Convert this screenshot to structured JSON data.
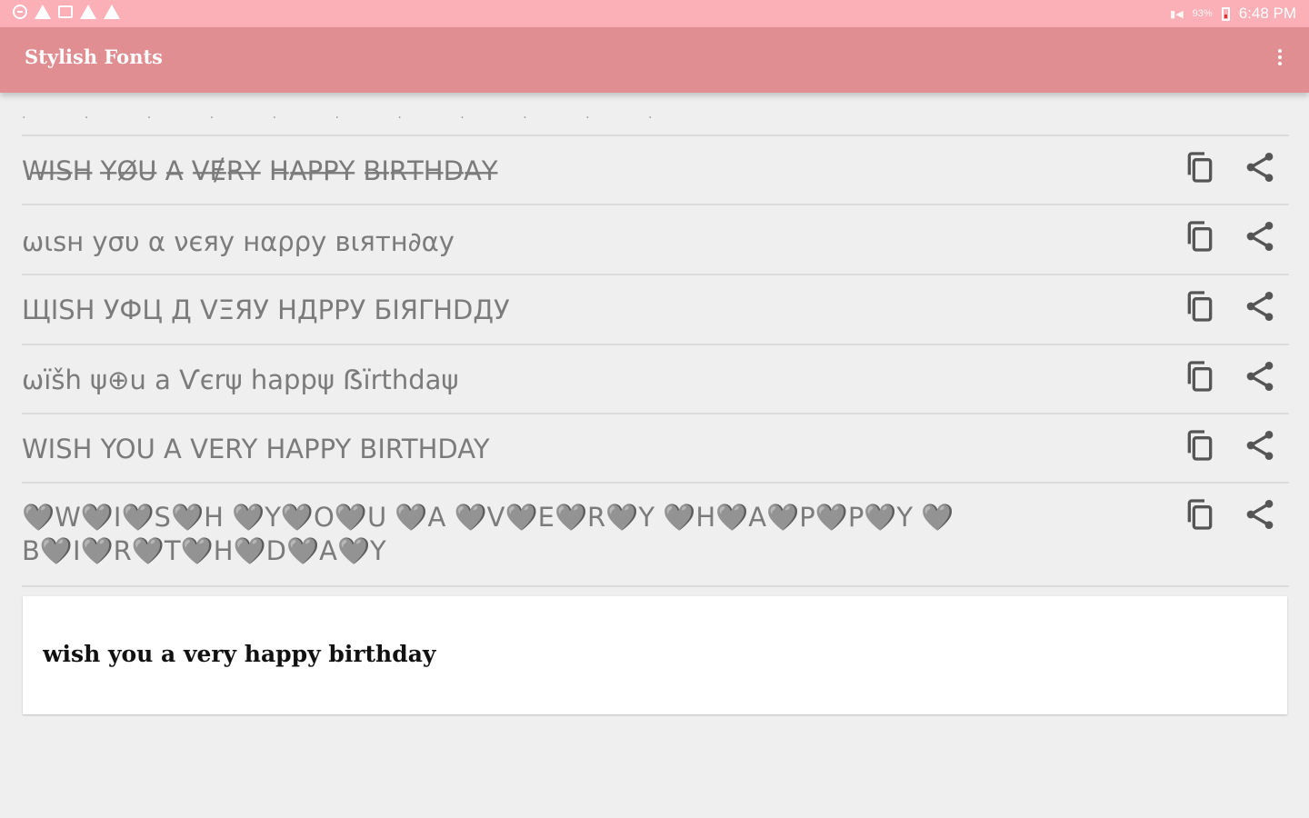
{
  "status_bar": {
    "left_icons": [
      "minus-circle-icon",
      "warning-icon",
      "mail-icon",
      "warning-icon",
      "warning-icon"
    ],
    "battery_percent": "93%",
    "time": "6:48 PM"
  },
  "app_bar": {
    "title": "Stylish Fonts",
    "overflow_icon": "more-vert-icon"
  },
  "partial_row": {
    "text": "· · · · · · · · · · ·"
  },
  "rows": [
    {
      "text": "W̶I̶S̶H̶ Y̶Ø̶U̶ A̶ V̶Ɇ̶R̶Y̶ H̶A̶P̶P̶Y̶ B̶I̶R̶T̶H̶D̶A̶Y̶",
      "copy_icon": "copy-icon",
      "share_icon": "share-icon"
    },
    {
      "text": "ωιѕн уσυ α νєяу нαρρу вιятн∂αу",
      "copy_icon": "copy-icon",
      "share_icon": "share-icon"
    },
    {
      "text": "ЩISH УФЦ Д VΞЯУ HДPPУ БIЯΓHDДУ",
      "copy_icon": "copy-icon",
      "share_icon": "share-icon"
    },
    {
      "text": "ωïšh ψ⊕u a Ѵєrψ happψ ẞïrthdaψ",
      "copy_icon": "copy-icon",
      "share_icon": "share-icon"
    },
    {
      "text": "WISH  YOU  A  VERY  HAPPY  BIRTHDAY",
      "copy_icon": "copy-icon",
      "share_icon": "share-icon"
    },
    {
      "text": "🩶W🩶I🩶S🩶H 🩶Y🩶O🩶U 🩶A 🩶V🩶E🩶R🩶Y 🩶H🩶A🩶P🩶P🩶Y 🩶B🩶I🩶R🩶T🩶H🩶D🩶A🩶Y",
      "copy_icon": "copy-icon",
      "share_icon": "share-icon"
    }
  ],
  "input": {
    "value": "wish you a very happy birthday"
  }
}
